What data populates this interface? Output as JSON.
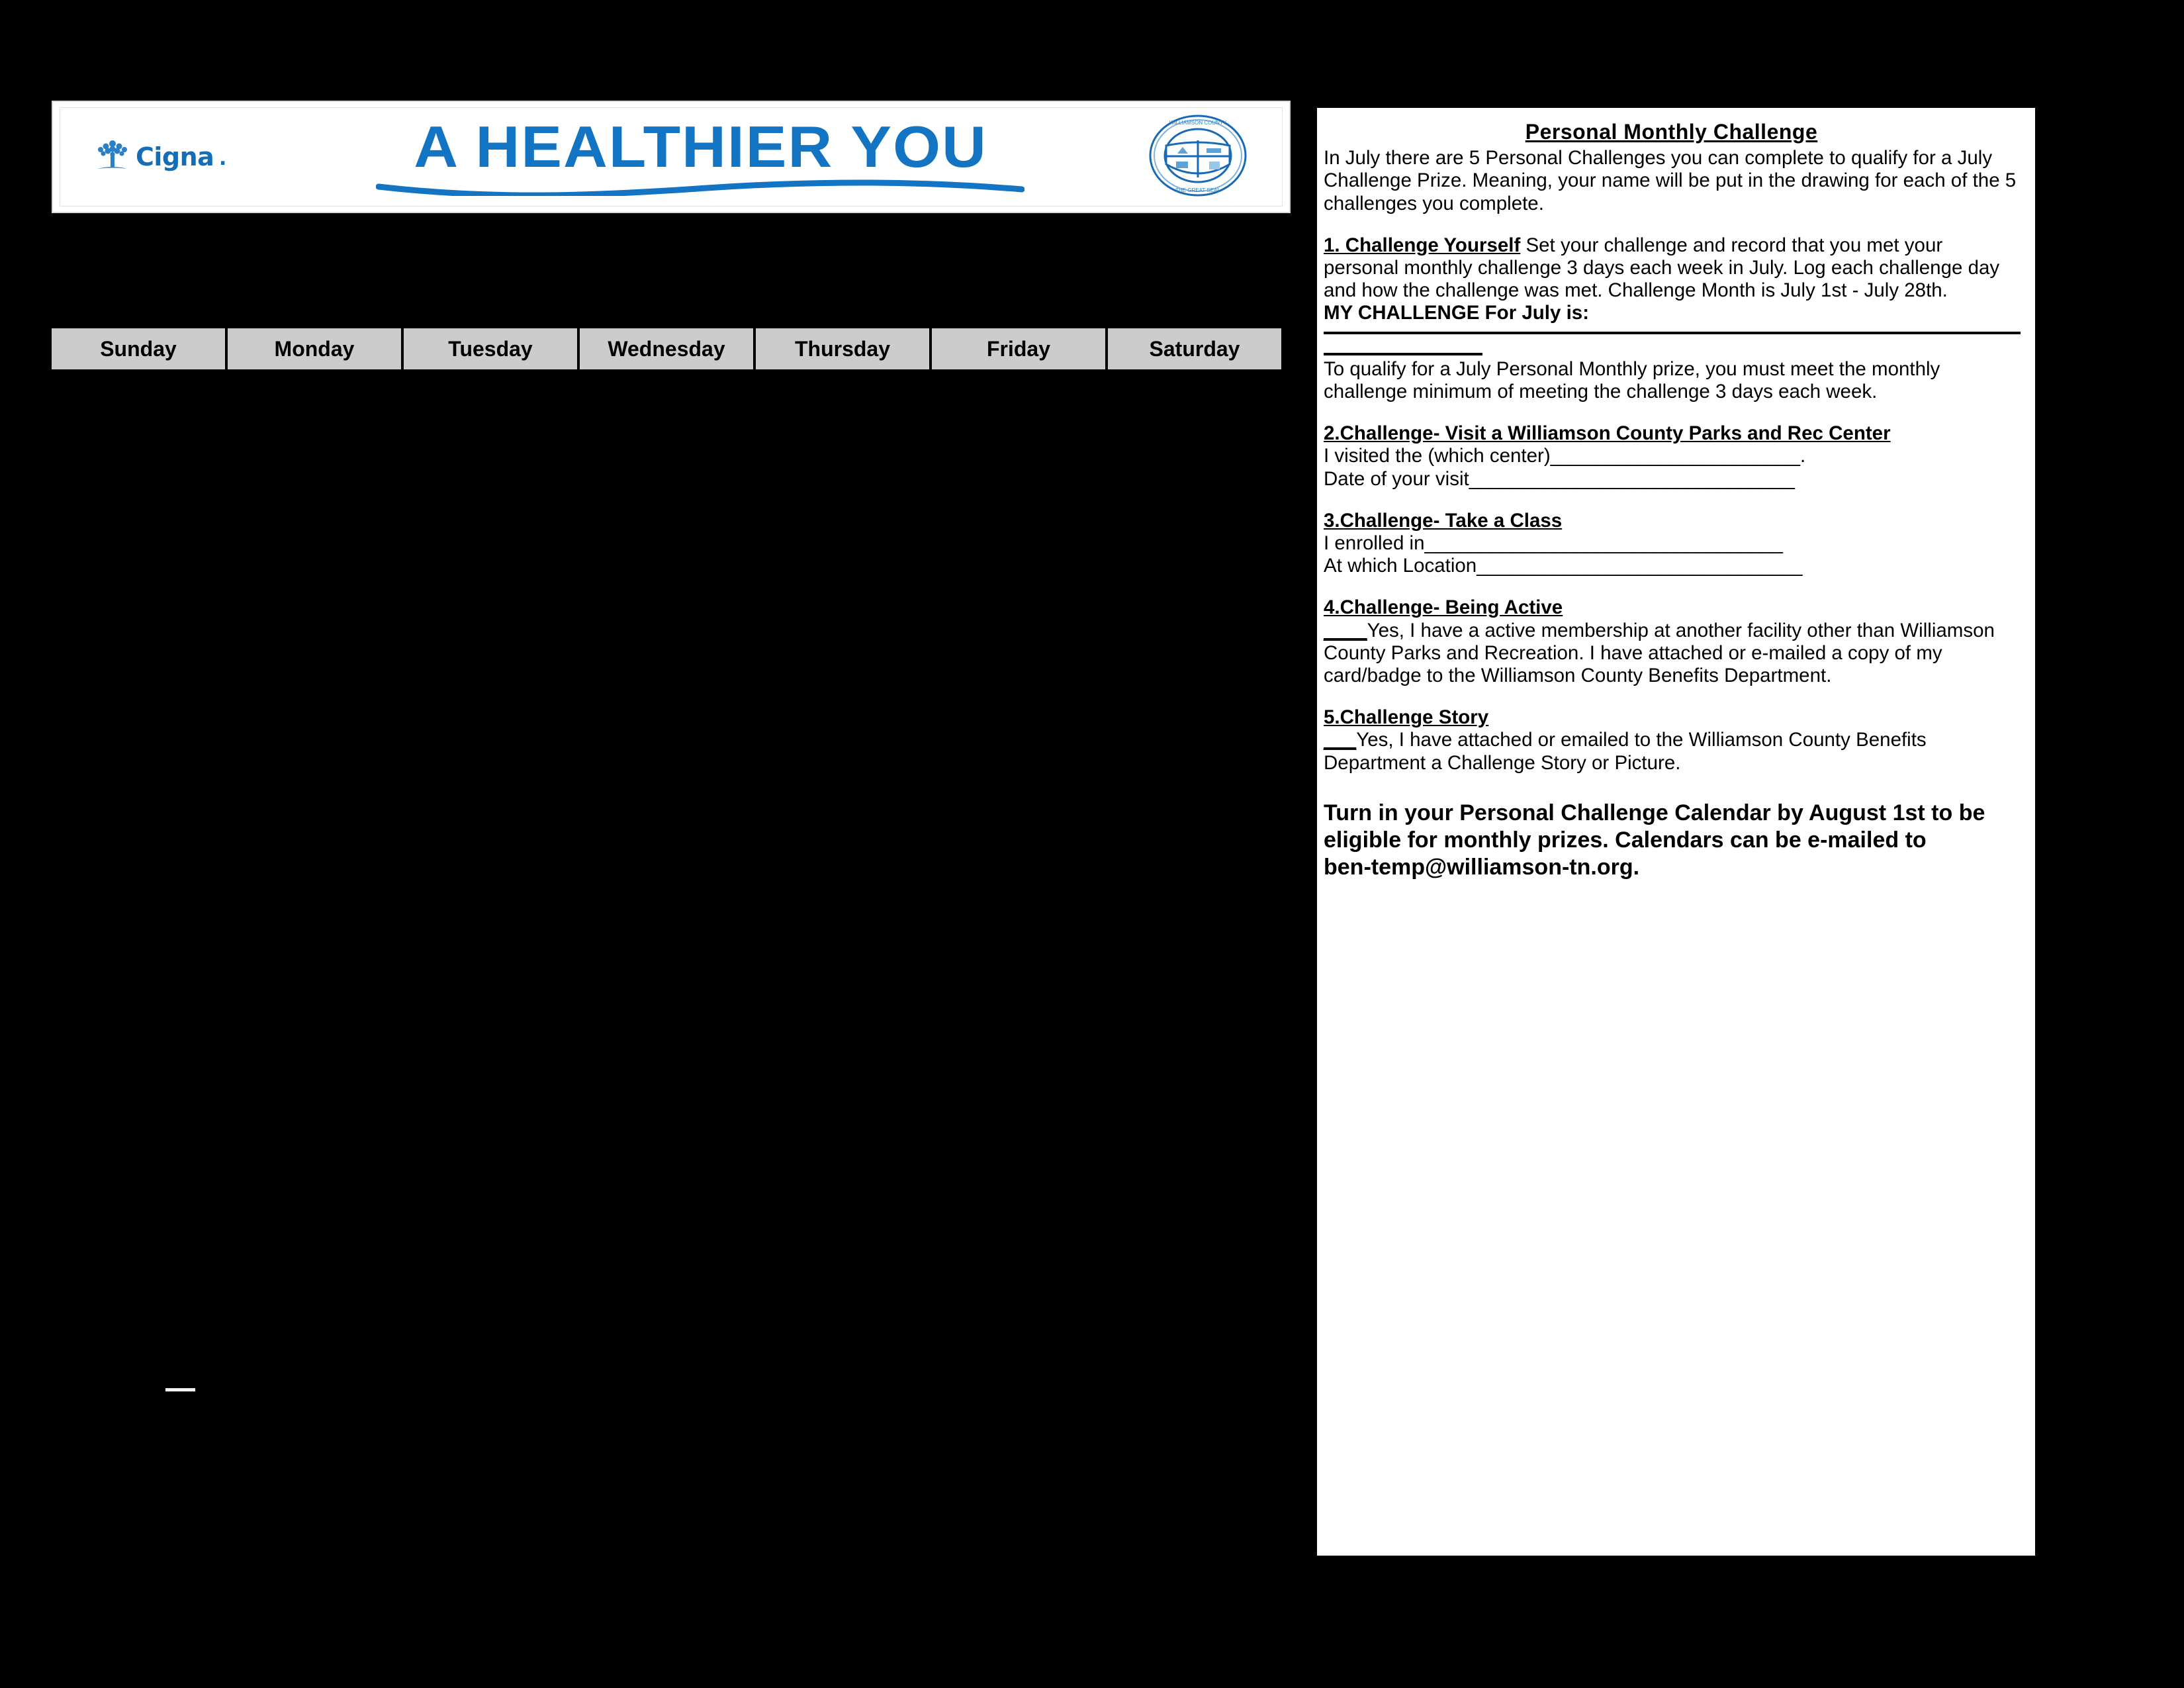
{
  "banner": {
    "brand": "Cigna",
    "headline": "A HEALTHIER YOU",
    "seal_name": "williamson-county-tennessee-seal",
    "seal_text_top": "WILLIAMSON COUNTY TENNESSEE",
    "seal_text_bottom": "THE GREAT SEAL",
    "brand_color": "#1474c4"
  },
  "calendar": {
    "day_headers": [
      "Sunday",
      "Monday",
      "Tuesday",
      "Wednesday",
      "Thursday",
      "Friday",
      "Saturday"
    ],
    "header_bg": "#cccccc"
  },
  "panel": {
    "title": "Personal Monthly Challenge",
    "intro": "In July there are 5 Personal Challenges you can complete to qualify for a July Challenge Prize.  Meaning, your name will be put in the drawing for each of the 5 challenges you complete.",
    "challenge1": {
      "heading": "1. Challenge Yourself",
      "body": " Set your challenge and record that you met your personal monthly challenge 3 days each week in July.  Log each challenge day and how the challenge was met.  Challenge Month is July 1st - July 28th.",
      "my_challenge_label": "MY CHALLENGE For July is:",
      "qualify_text": "To qualify for a July Personal Monthly prize, you must meet the monthly challenge minimum of meeting the challenge 3 days each week."
    },
    "challenge2": {
      "heading": "2.Challenge- Visit a Williamson County Parks and Rec Center ",
      "line1_label": "I visited the (which center)",
      "line1_blank": "_______________________.",
      "line2_label": "Date of your visit",
      "line2_blank": "______________________________"
    },
    "challenge3": {
      "heading": "3.Challenge- Take a Class ",
      "line1_label": "I enrolled in",
      "line1_blank": "_________________________________",
      "line2_label": "At which Location",
      "line2_blank": "______________________________"
    },
    "challenge4": {
      "heading": "4.Challenge- Being Active",
      "blank": "____",
      "body": "Yes, I have a active membership at another facility other than Williamson County Parks and Recreation.  I have attached or e-mailed a copy of my card/badge to the Williamson County Benefits Department."
    },
    "challenge5": {
      "heading": "5.Challenge Story",
      "blank": "___",
      "body": "Yes, I have attached or emailed to the Williamson County Benefits Department a Challenge Story or Picture."
    },
    "closing": {
      "part1": "Turn in your Personal Challenge Calendar by August 1st to be eligible for monthly prizes",
      "part2": ".  Calendars can be e-mailed to",
      "email": "ben-temp@williamson-tn.org."
    }
  }
}
